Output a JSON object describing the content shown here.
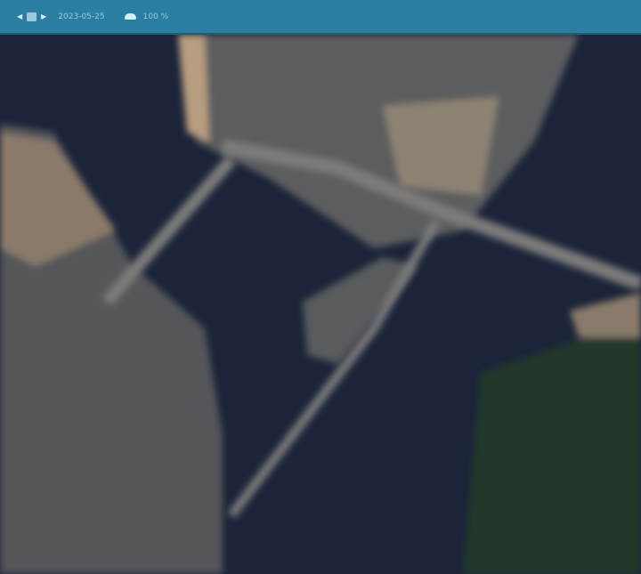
{
  "toolbar": {
    "date": "2023-05-25",
    "cloud_coverage": "100 %",
    "icons": [
      "arrow-left-icon",
      "calendar-icon",
      "arrow-right-icon",
      "cloud-icon"
    ]
  },
  "colors": {
    "toolbar": "#2a7ea0",
    "water": "#1a2338",
    "land": "#5a5a5c",
    "vegetation": "#1f3a2c"
  }
}
